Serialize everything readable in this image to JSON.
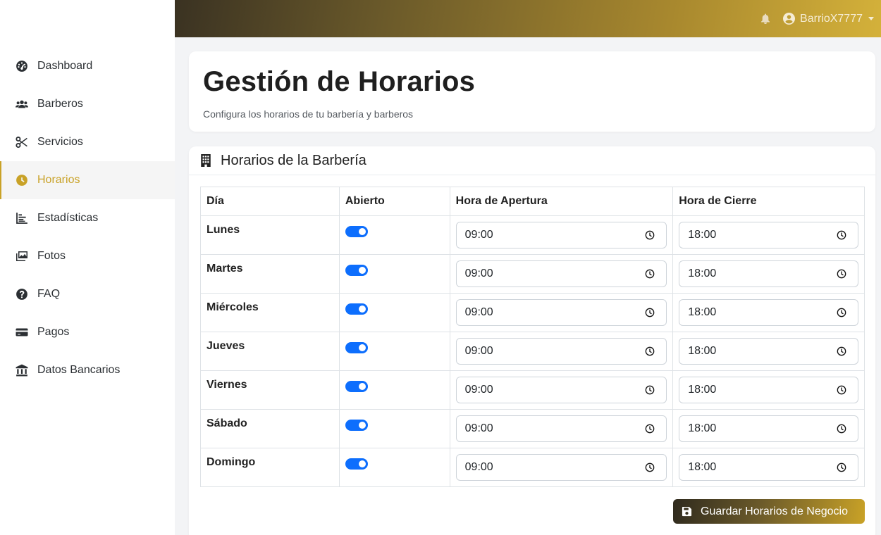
{
  "sidebar": {
    "items": [
      {
        "label": "Dashboard",
        "icon": "gauge-icon"
      },
      {
        "label": "Barberos",
        "icon": "users-icon"
      },
      {
        "label": "Servicios",
        "icon": "scissors-icon"
      },
      {
        "label": "Horarios",
        "icon": "clock-icon",
        "active": true
      },
      {
        "label": "Estadísticas",
        "icon": "chart-icon"
      },
      {
        "label": "Fotos",
        "icon": "images-icon"
      },
      {
        "label": "FAQ",
        "icon": "question-icon"
      },
      {
        "label": "Pagos",
        "icon": "credit-card-icon"
      },
      {
        "label": "Datos Bancarios",
        "icon": "bank-icon"
      }
    ]
  },
  "topbar": {
    "username": "BarrioX7777"
  },
  "header": {
    "title": "Gestión de Horarios",
    "subtitle": "Configura los horarios de tu barbería y barberos"
  },
  "schedule": {
    "title": "Horarios de la Barbería",
    "columns": [
      "Día",
      "Abierto",
      "Hora de Apertura",
      "Hora de Cierre"
    ],
    "rows": [
      {
        "day": "Lunes",
        "open": true,
        "opening": "09:00",
        "closing": "18:00"
      },
      {
        "day": "Martes",
        "open": true,
        "opening": "09:00",
        "closing": "18:00"
      },
      {
        "day": "Miércoles",
        "open": true,
        "opening": "09:00",
        "closing": "18:00"
      },
      {
        "day": "Jueves",
        "open": true,
        "opening": "09:00",
        "closing": "18:00"
      },
      {
        "day": "Viernes",
        "open": true,
        "opening": "09:00",
        "closing": "18:00"
      },
      {
        "day": "Sábado",
        "open": true,
        "opening": "09:00",
        "closing": "18:00"
      },
      {
        "day": "Domingo",
        "open": true,
        "opening": "09:00",
        "closing": "18:00"
      }
    ],
    "save_label": "Guardar Horarios de Negocio"
  },
  "colors": {
    "accent": "#c9a227",
    "toggle_on": "#0d6efd"
  }
}
